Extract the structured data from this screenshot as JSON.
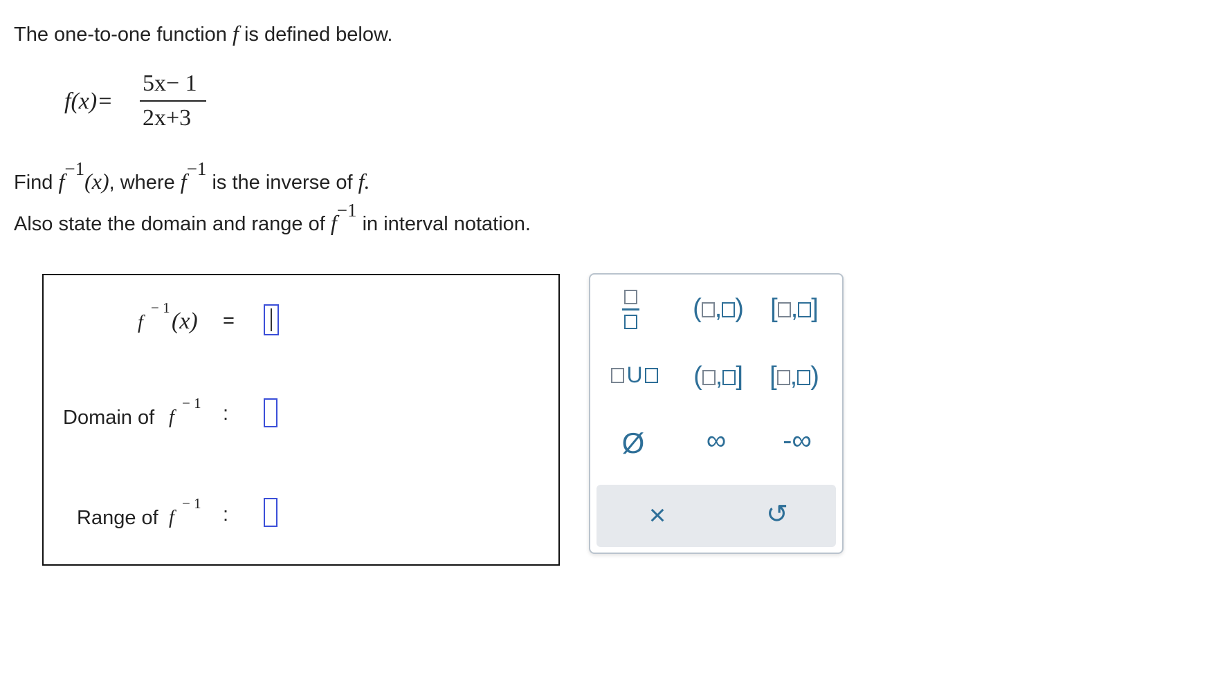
{
  "problem": {
    "intro_pre": "The one-to-one function",
    "intro_f": "f",
    "intro_post": "is defined below.",
    "def_lhs": "f(x)=",
    "def_numerator": "5x− 1",
    "def_denominator": "2x+3",
    "find_label": "Find",
    "find_f": "f",
    "find_exp": "−1",
    "find_arg": "(x)",
    "find_where": ", where",
    "where_f": "f",
    "where_exp": "−1",
    "inverse_text": "is the inverse of",
    "inverse_f": "f.",
    "also_text": "Also state the domain and range of",
    "also_f": "f",
    "also_exp": "−1",
    "also_post": "in interval notation."
  },
  "answer": {
    "inv_f": "f",
    "inv_exp": "− 1",
    "inv_arg": "(x)",
    "equals": "=",
    "domain_label": "Domain of",
    "domain_f": "f",
    "domain_exp": "− 1",
    "domain_colon": ":",
    "range_label": "Range of",
    "range_f": "f",
    "range_exp": "− 1",
    "range_colon": ":"
  },
  "palette": {
    "union_symbol": "U",
    "comma": ",",
    "open_paren": "(",
    "close_paren": ")",
    "open_bracket": "[",
    "close_bracket": "]",
    "empty_set": "Ø",
    "infinity": "∞",
    "neg_infinity": "-∞",
    "clear": "×",
    "undo": "↺"
  },
  "colors": {
    "accent": "#2e6f98",
    "blank_border": "#3b4fd8",
    "palette_border": "#b9c3cd",
    "bottom_bar": "#e6e9ed"
  }
}
